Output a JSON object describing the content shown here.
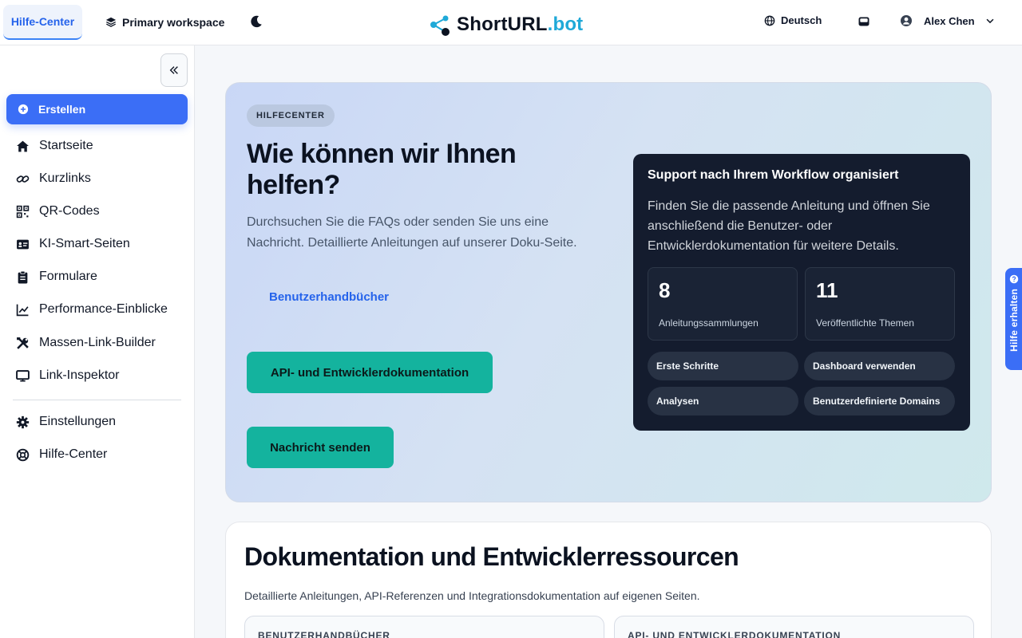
{
  "topbar": {
    "active_tab": "Hilfe-Center",
    "workspace": "Primary workspace",
    "logo_part1": "ShortURL",
    "logo_part2": ".bot",
    "language": "Deutsch",
    "user_name": "Alex Chen"
  },
  "sidebar": {
    "create_label": "Erstellen",
    "items": [
      {
        "label": "Startseite",
        "icon": "home-icon"
      },
      {
        "label": "Kurzlinks",
        "icon": "link-icon"
      },
      {
        "label": "QR-Codes",
        "icon": "qr-code-icon"
      },
      {
        "label": "KI-Smart-Seiten",
        "icon": "id-card-icon"
      },
      {
        "label": "Formulare",
        "icon": "clipboard-icon"
      },
      {
        "label": "Performance-Einblicke",
        "icon": "chart-line-icon"
      },
      {
        "label": "Massen-Link-Builder",
        "icon": "tools-icon"
      },
      {
        "label": "Link-Inspektor",
        "icon": "monitor-icon"
      }
    ],
    "bottom_items": [
      {
        "label": "Einstellungen",
        "icon": "gear-icon"
      },
      {
        "label": "Hilfe-Center",
        "icon": "lifebuoy-icon"
      }
    ]
  },
  "hero": {
    "badge": "HILFECENTER",
    "title": "Wie können wir Ihnen helfen?",
    "description": "Durchsuchen Sie die FAQs oder senden Sie uns eine Nachricht. Detaillierte Anleitungen auf unserer Doku-Seite.",
    "link_user_guides": "Benutzerhandbücher",
    "btn_api_docs": "API- und Entwicklerdokumentation",
    "btn_send_message": "Nachricht senden"
  },
  "support_card": {
    "title": "Support nach Ihrem Workflow organisiert",
    "description": "Finden Sie die passende Anleitung und öffnen Sie anschließend die Benutzer- oder Entwicklerdokumentation für weitere Details.",
    "stats": [
      {
        "value": "8",
        "label": "Anleitungssammlungen"
      },
      {
        "value": "11",
        "label": "Veröffentlichte Themen"
      }
    ],
    "chips": [
      "Erste Schritte",
      "Dashboard verwenden",
      "Analysen",
      "Benutzerdefinierte Domains"
    ]
  },
  "docs": {
    "title": "Dokumentation und Entwicklerressourcen",
    "description": "Detaillierte Anleitungen, API-Referenzen und Integrationsdokumentation auf eigenen Seiten.",
    "card_user": "BENUTZERHANDBÜCHER",
    "card_api": "API- UND ENTWICKLERDOKUMENTATION"
  },
  "help_tab": "Hilfe erhalten",
  "colors": {
    "accent": "#3b6ef6",
    "teal": "#14b39e",
    "dark_card": "#141c2e"
  }
}
